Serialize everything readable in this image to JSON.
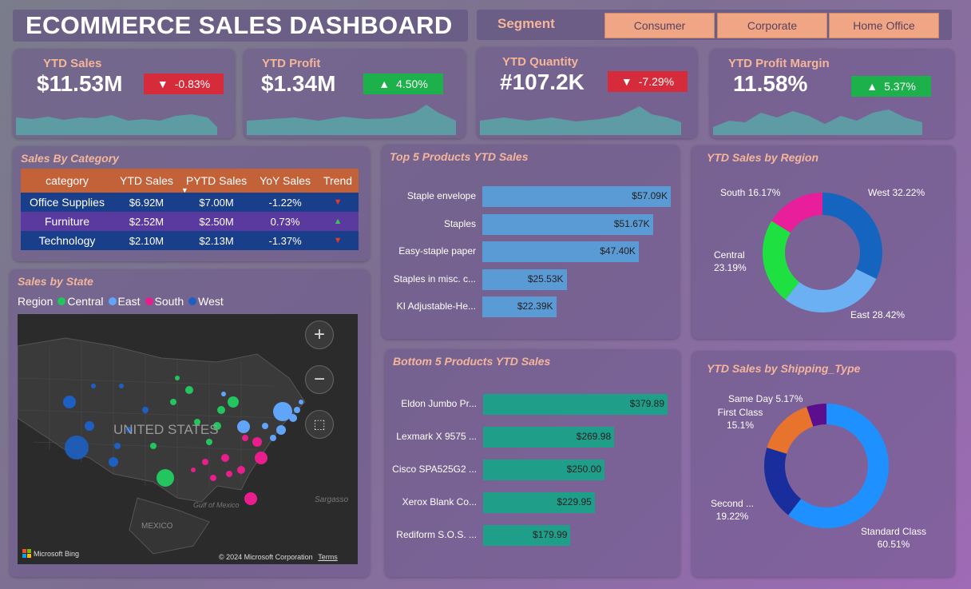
{
  "header": {
    "title": "ECOMMERCE SALES DASHBOARD"
  },
  "segment": {
    "label": "Segment",
    "options": [
      "Consumer",
      "Corporate",
      "Home Office"
    ]
  },
  "kpis": [
    {
      "label": "YTD Sales",
      "value": "$11.53M",
      "change": "-0.83%",
      "direction": "down",
      "color": "#d62b3a"
    },
    {
      "label": "YTD Profit",
      "value": "$1.34M",
      "change": "4.50%",
      "direction": "up",
      "color": "#1db14b"
    },
    {
      "label": "YTD Quantity",
      "value": "#107.2K",
      "change": "-7.29%",
      "direction": "down",
      "color": "#d62b3a"
    },
    {
      "label": "YTD Profit Margin",
      "value": "11.58%",
      "change": "5.37%",
      "direction": "up",
      "color": "#1db14b"
    }
  ],
  "sales_by_category": {
    "title": "Sales By Category",
    "columns": [
      "category",
      "YTD Sales",
      "PYTD Sales",
      "YoY Sales",
      "Trend"
    ],
    "rows": [
      {
        "category": "Office Supplies",
        "ytd": "$6.92M",
        "pytd": "$7.00M",
        "yoy": "-1.22%",
        "trend": "down"
      },
      {
        "category": "Furniture",
        "ytd": "$2.52M",
        "pytd": "$2.50M",
        "yoy": "0.73%",
        "trend": "up"
      },
      {
        "category": "Technology",
        "ytd": "$2.10M",
        "pytd": "$2.13M",
        "yoy": "-1.37%",
        "trend": "down"
      }
    ]
  },
  "sales_by_state": {
    "title": "Sales by State",
    "legend_title": "Region",
    "legend": [
      {
        "name": "Central",
        "color": "#22c55e"
      },
      {
        "name": "East",
        "color": "#60a5fa"
      },
      {
        "name": "South",
        "color": "#e91e8c"
      },
      {
        "name": "West",
        "color": "#1e5fc4"
      }
    ],
    "map_text": {
      "country": "UNITED STATES",
      "mexico": "MEXICO",
      "gulf": "Gulf of Mexico",
      "sargasso": "Sargasso",
      "bing": "Microsoft Bing",
      "copyright": "© 2024 Microsoft Corporation",
      "terms": "Terms"
    }
  },
  "chart_data": [
    {
      "type": "bar",
      "title": "Top 5 Products YTD Sales",
      "categories": [
        "Staple envelope",
        "Staples",
        "Easy-staple paper",
        "Staples in misc. c...",
        "KI Adjustable-He..."
      ],
      "values": [
        57090,
        51670,
        47400,
        25530,
        22390
      ],
      "labels": [
        "$57.09K",
        "$51.67K",
        "$47.40K",
        "$25.53K",
        "$22.39K"
      ],
      "color": "#5b9bd5"
    },
    {
      "type": "bar",
      "title": "Bottom 5 Products YTD Sales",
      "categories": [
        "Eldon Jumbo Pr...",
        "Lexmark X 9575 ...",
        "Cisco SPA525G2 ...",
        "Xerox Blank Co...",
        "Rediform S.O.S. ..."
      ],
      "values": [
        379.89,
        269.98,
        250.0,
        229.95,
        179.99
      ],
      "labels": [
        "$379.89",
        "$269.98",
        "$250.00",
        "$229.95",
        "$179.99"
      ],
      "color": "#1f9e89"
    },
    {
      "type": "pie",
      "title": "YTD Sales by Region",
      "categories": [
        "West",
        "East",
        "Central",
        "South"
      ],
      "values": [
        32.22,
        28.42,
        23.19,
        16.17
      ],
      "colors": [
        "#1565c0",
        "#6ab0f3",
        "#1ee040",
        "#e91e9b"
      ],
      "labels": [
        "West 32.22%",
        "East 28.42%",
        "Central 23.19%",
        "South 16.17%"
      ]
    },
    {
      "type": "pie",
      "title": "YTD Sales by Shipping_Type",
      "categories": [
        "Standard Class",
        "Second Class",
        "First Class",
        "Same Day"
      ],
      "values": [
        60.51,
        19.22,
        15.1,
        5.17
      ],
      "colors": [
        "#1e90ff",
        "#1a2d9c",
        "#e8732c",
        "#5b0f8e"
      ],
      "labels": [
        "Standard Class 60.51%",
        "Second ... 19.22%",
        "First Class 15.1%",
        "Same Day 5.17%"
      ]
    }
  ]
}
